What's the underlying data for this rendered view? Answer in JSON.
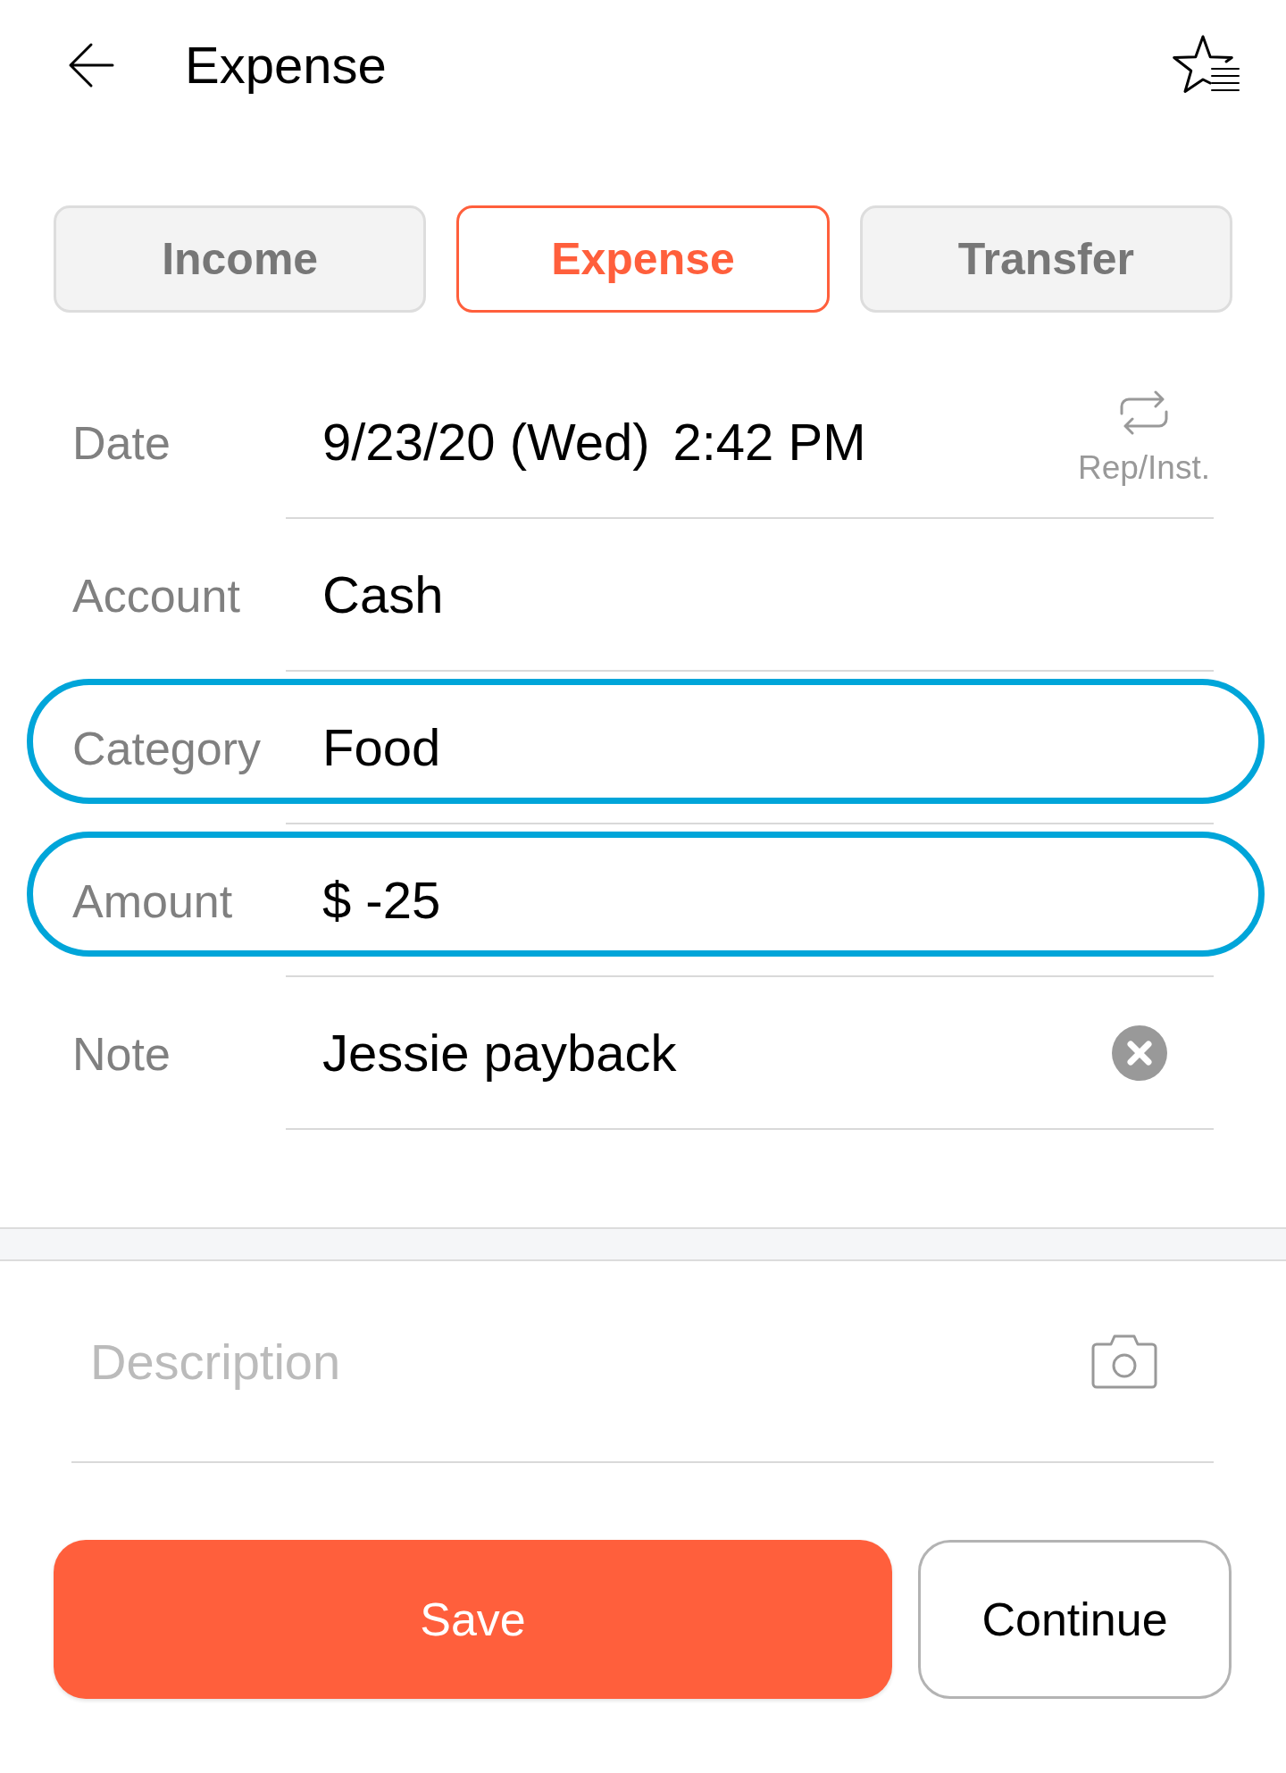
{
  "header": {
    "title": "Expense"
  },
  "tabs": [
    {
      "label": "Income",
      "selected": false
    },
    {
      "label": "Expense",
      "selected": true
    },
    {
      "label": "Transfer",
      "selected": false
    }
  ],
  "fields": [
    {
      "kind": "datetime",
      "label": "Date",
      "date": "9/23/20 (Wed)",
      "time": "2:42 PM",
      "action_label": "Rep/Inst.",
      "highlighted": false
    },
    {
      "kind": "plain",
      "label": "Account",
      "value": "Cash",
      "highlighted": false
    },
    {
      "kind": "plain",
      "label": "Category",
      "value": "Food",
      "highlighted": true
    },
    {
      "kind": "plain",
      "label": "Amount",
      "value": "$ -25",
      "highlighted": true
    },
    {
      "kind": "clearable",
      "label": "Note",
      "value": "Jessie payback",
      "highlighted": false
    }
  ],
  "description": {
    "placeholder": "Description"
  },
  "buttons": [
    {
      "kind": "primary",
      "label": "Save"
    },
    {
      "kind": "secondary",
      "label": "Continue"
    }
  ]
}
